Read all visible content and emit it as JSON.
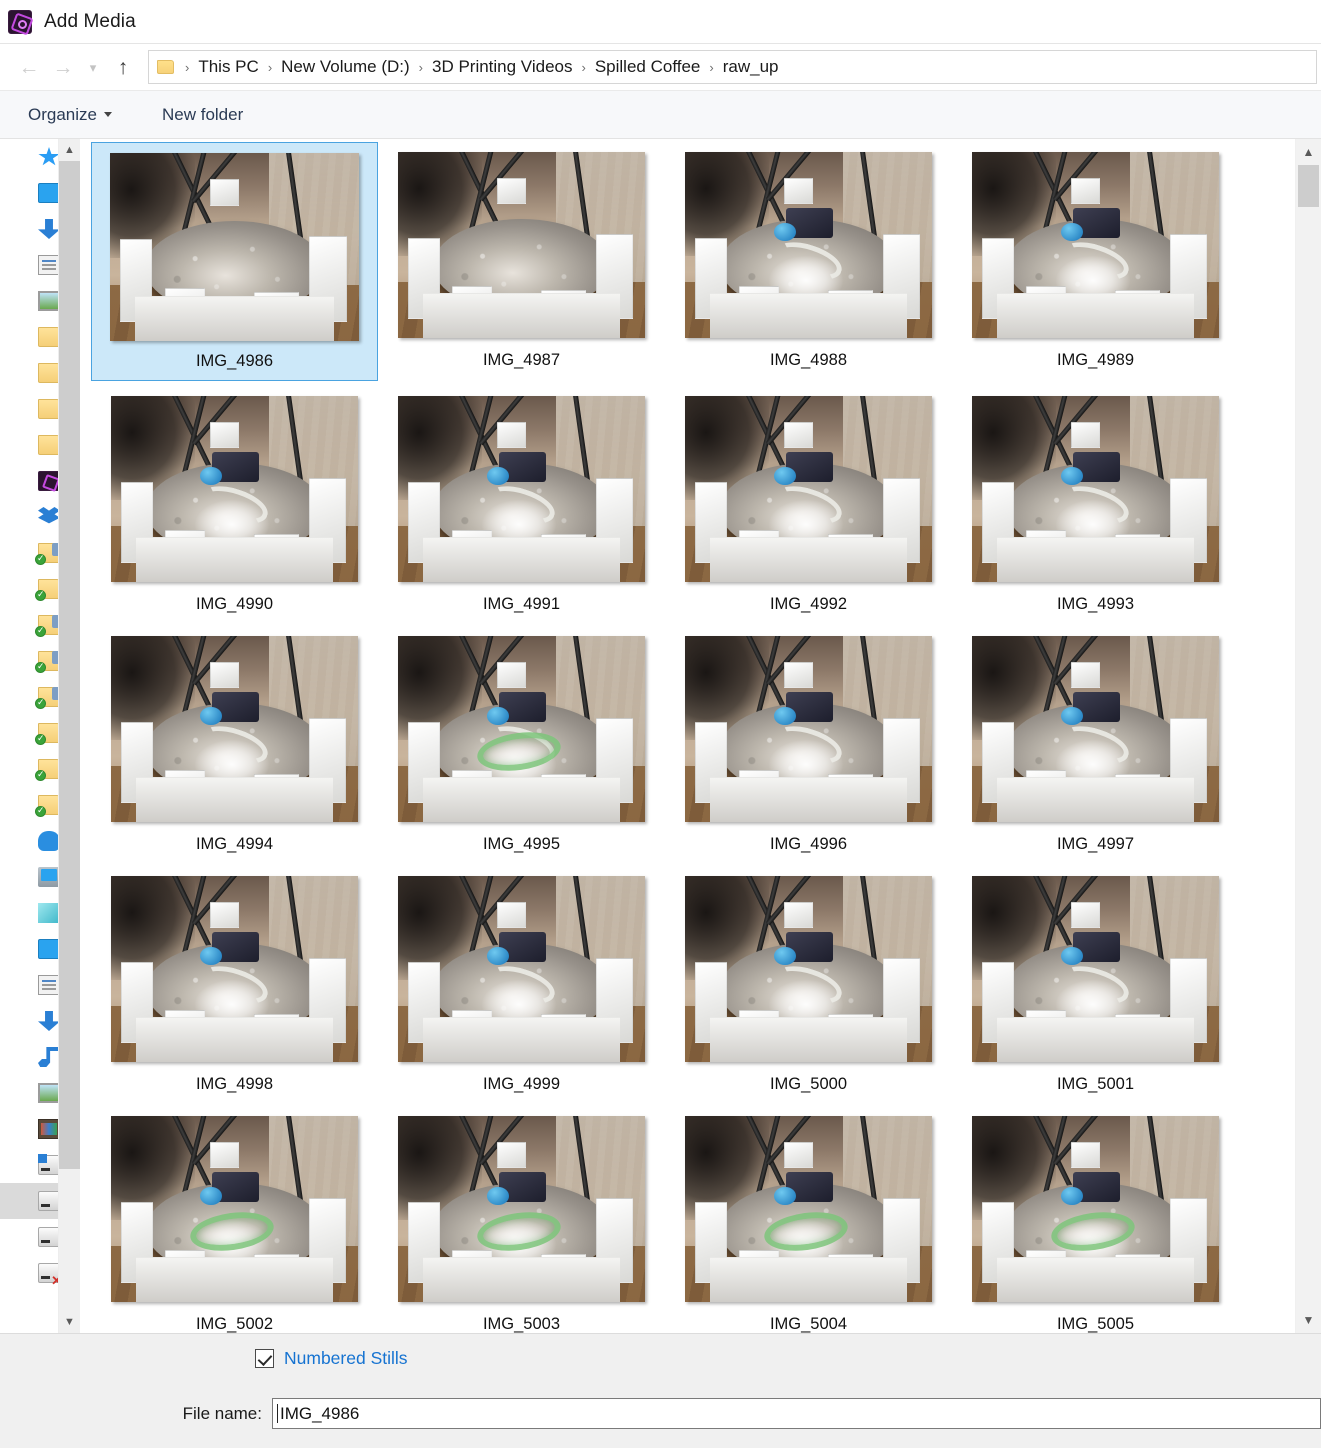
{
  "window": {
    "title": "Add Media",
    "app_icon": "adobe-premiere-icon"
  },
  "nav": {
    "back_icon": "arrow-left-icon",
    "forward_icon": "arrow-right-icon",
    "recent_icon": "chevron-down-icon",
    "up_icon": "arrow-up-icon",
    "breadcrumb_folder_icon": "folder-icon",
    "separator": "›",
    "breadcrumbs": [
      "This PC",
      "New Volume (D:)",
      "3D Printing Videos",
      "Spilled Coffee",
      "raw_up"
    ]
  },
  "toolbar": {
    "organize_label": "Organize",
    "new_folder_label": "New folder"
  },
  "sidebar": {
    "scroll_up_icon": "chevron-up-icon",
    "scroll_down_icon": "chevron-down-icon",
    "items": [
      {
        "label": "Quick access",
        "icon": "quick-access-star-icon",
        "icon_class": "ic-star",
        "selected": false
      },
      {
        "label": "Desktop",
        "icon": "desktop-icon",
        "icon_class": "ic-monitor",
        "selected": false
      },
      {
        "label": "Downloads",
        "icon": "downloads-icon",
        "icon_class": "ic-download",
        "selected": false
      },
      {
        "label": "Documents",
        "icon": "documents-icon",
        "icon_class": "ic-doc",
        "selected": false
      },
      {
        "label": "Pictures",
        "icon": "pictures-icon",
        "icon_class": "ic-pic",
        "selected": false
      },
      {
        "label": "Folder",
        "icon": "folder-icon",
        "icon_class": "ic-folder",
        "selected": false
      },
      {
        "label": "Folder",
        "icon": "folder-icon",
        "icon_class": "ic-folder",
        "selected": false
      },
      {
        "label": "Folder",
        "icon": "folder-icon",
        "icon_class": "ic-folder",
        "selected": false
      },
      {
        "label": "Folder",
        "icon": "folder-icon",
        "icon_class": "ic-folder",
        "selected": false
      },
      {
        "label": "Adobe",
        "icon": "adobe-icon",
        "icon_class": "ic-purple",
        "selected": false
      },
      {
        "label": "Dropbox",
        "icon": "dropbox-icon",
        "icon_class": "ic-dropbox",
        "selected": false
      },
      {
        "label": "Shared Folder",
        "icon": "shared-folder-icon",
        "icon_class": "ic-folder shared synced",
        "selected": false
      },
      {
        "label": "Camera Uploads",
        "icon": "camera-folder-icon",
        "icon_class": "ic-folder synced",
        "selected": false
      },
      {
        "label": "Shared Folder",
        "icon": "shared-folder-icon",
        "icon_class": "ic-folder shared synced",
        "selected": false
      },
      {
        "label": "Shared Folder",
        "icon": "shared-folder-icon",
        "icon_class": "ic-folder shared synced",
        "selected": false
      },
      {
        "label": "Shared Folder",
        "icon": "shared-folder-icon",
        "icon_class": "ic-folder shared synced",
        "selected": false
      },
      {
        "label": "Synced Folder",
        "icon": "synced-folder-icon",
        "icon_class": "ic-folder synced",
        "selected": false
      },
      {
        "label": "Synced Folder",
        "icon": "synced-folder-icon",
        "icon_class": "ic-folder synced",
        "selected": false
      },
      {
        "label": "Synced Folder",
        "icon": "synced-folder-icon",
        "icon_class": "ic-folder synced",
        "selected": false
      },
      {
        "label": "OneDrive",
        "icon": "onedrive-cloud-icon",
        "icon_class": "ic-cloud",
        "selected": false
      },
      {
        "label": "This PC",
        "icon": "this-pc-icon",
        "icon_class": "ic-pc",
        "selected": false
      },
      {
        "label": "3D Objects",
        "icon": "3d-objects-icon",
        "icon_class": "ic-cube",
        "selected": false
      },
      {
        "label": "Desktop",
        "icon": "desktop-icon",
        "icon_class": "ic-monitor",
        "selected": false
      },
      {
        "label": "Documents",
        "icon": "documents-icon",
        "icon_class": "ic-doc",
        "selected": false
      },
      {
        "label": "Downloads",
        "icon": "downloads-icon",
        "icon_class": "ic-download",
        "selected": false
      },
      {
        "label": "Music",
        "icon": "music-icon",
        "icon_class": "ic-music",
        "selected": false
      },
      {
        "label": "Pictures",
        "icon": "pictures-icon",
        "icon_class": "ic-pic",
        "selected": false
      },
      {
        "label": "Videos",
        "icon": "videos-icon",
        "icon_class": "ic-film",
        "selected": false
      },
      {
        "label": "Local Disk (C:)",
        "icon": "windows-drive-icon",
        "icon_class": "ic-drive ic-drive-win",
        "selected": false
      },
      {
        "label": "New Volume (D:)",
        "icon": "drive-icon",
        "icon_class": "ic-drive",
        "selected": true
      },
      {
        "label": "New Volume (E:)",
        "icon": "drive-icon",
        "icon_class": "ic-drive",
        "selected": false
      },
      {
        "label": "Disconnected Drive",
        "icon": "drive-disconnected-icon",
        "icon_class": "ic-drive ic-drive-x",
        "selected": false
      }
    ]
  },
  "grid": {
    "scroll_up_icon": "chevron-up-icon",
    "scroll_down_icon": "chevron-down-icon",
    "selected_item": "IMG_4986",
    "items": [
      {
        "label": "IMG_4986",
        "variant": "bed-plain",
        "selected": true
      },
      {
        "label": "IMG_4987",
        "variant": "bed-plain",
        "selected": false
      },
      {
        "label": "IMG_4988",
        "variant": "arc",
        "selected": false
      },
      {
        "label": "IMG_4989",
        "variant": "arc",
        "selected": false
      },
      {
        "label": "IMG_4990",
        "variant": "arc",
        "selected": false
      },
      {
        "label": "IMG_4991",
        "variant": "arc",
        "selected": false
      },
      {
        "label": "IMG_4992",
        "variant": "arc",
        "selected": false
      },
      {
        "label": "IMG_4993",
        "variant": "arc",
        "selected": false
      },
      {
        "label": "IMG_4994",
        "variant": "arc",
        "selected": false
      },
      {
        "label": "IMG_4995",
        "variant": "arc-green",
        "selected": false
      },
      {
        "label": "IMG_4996",
        "variant": "arc",
        "selected": false
      },
      {
        "label": "IMG_4997",
        "variant": "arc",
        "selected": false
      },
      {
        "label": "IMG_4998",
        "variant": "arc",
        "selected": false
      },
      {
        "label": "IMG_4999",
        "variant": "arc",
        "selected": false
      },
      {
        "label": "IMG_5000",
        "variant": "arc",
        "selected": false
      },
      {
        "label": "IMG_5001",
        "variant": "arc",
        "selected": false
      },
      {
        "label": "IMG_5002",
        "variant": "green",
        "selected": false
      },
      {
        "label": "IMG_5003",
        "variant": "green",
        "selected": false
      },
      {
        "label": "IMG_5004",
        "variant": "green",
        "selected": false
      },
      {
        "label": "IMG_5005",
        "variant": "green",
        "selected": false
      },
      {
        "label": "",
        "variant": "partial",
        "selected": false
      },
      {
        "label": "",
        "variant": "partial",
        "selected": false
      },
      {
        "label": "",
        "variant": "partial",
        "selected": false
      },
      {
        "label": "",
        "variant": "partial",
        "selected": false
      }
    ]
  },
  "footer": {
    "numbered_stills_label": "Numbered Stills",
    "numbered_stills_checked": true,
    "file_name_label": "File name:",
    "file_name_value": "IMG_4986",
    "file_name_placeholder": "File name"
  },
  "colors": {
    "accent_link": "#1673d1",
    "selection_fill": "#cce8f9",
    "selection_border": "#4aa3e0",
    "sidebar_selected": "#dadada",
    "footer_bg": "#f0f0f0",
    "command_bar_bg": "#f7f8fa"
  }
}
